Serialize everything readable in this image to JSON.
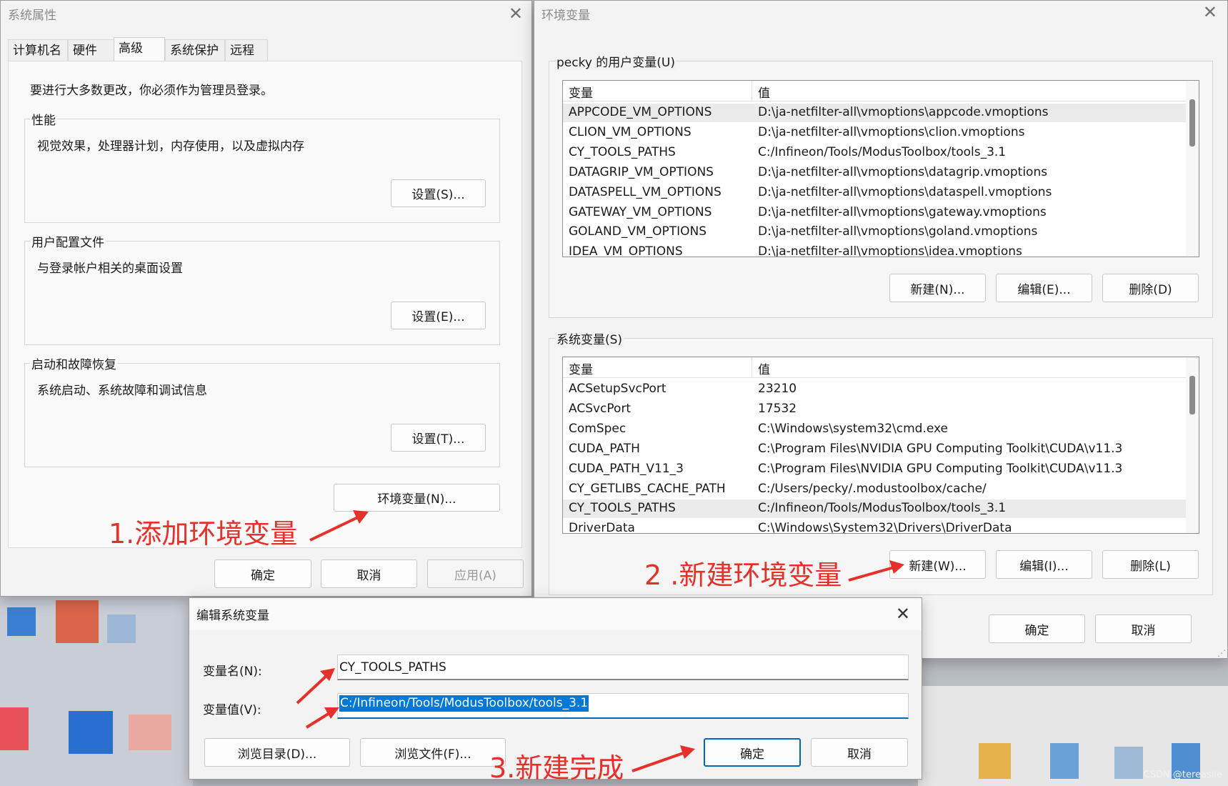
{
  "system_properties": {
    "title": "系统属性",
    "tabs": [
      "计算机名",
      "硬件",
      "高级",
      "系统保护",
      "远程"
    ],
    "admin_notice": "要进行大多数更改，你必须作为管理员登录。",
    "performance": {
      "heading": "性能",
      "description": "视觉效果，处理器计划，内存使用，以及虚拟内存",
      "button": "设置(S)..."
    },
    "user_profiles": {
      "heading": "用户配置文件",
      "description": "与登录帐户相关的桌面设置",
      "button": "设置(E)..."
    },
    "startup_recovery": {
      "heading": "启动和故障恢复",
      "description": "系统启动、系统故障和调试信息",
      "button": "设置(T)..."
    },
    "env_button": "环境变量(N)...",
    "ok": "确定",
    "cancel": "取消",
    "apply": "应用(A)"
  },
  "env_vars": {
    "title": "环境变量",
    "user_section": "pecky 的用户变量(U)",
    "system_section": "系统变量(S)",
    "col_var": "变量",
    "col_val": "值",
    "user_rows": [
      {
        "name": "APPCODE_VM_OPTIONS",
        "value": "D:\\ja-netfilter-all\\vmoptions\\appcode.vmoptions"
      },
      {
        "name": "CLION_VM_OPTIONS",
        "value": "D:\\ja-netfilter-all\\vmoptions\\clion.vmoptions"
      },
      {
        "name": "CY_TOOLS_PATHS",
        "value": "C:/Infineon/Tools/ModusToolbox/tools_3.1"
      },
      {
        "name": "DATAGRIP_VM_OPTIONS",
        "value": "D:\\ja-netfilter-all\\vmoptions\\datagrip.vmoptions"
      },
      {
        "name": "DATASPELL_VM_OPTIONS",
        "value": "D:\\ja-netfilter-all\\vmoptions\\dataspell.vmoptions"
      },
      {
        "name": "GATEWAY_VM_OPTIONS",
        "value": "D:\\ja-netfilter-all\\vmoptions\\gateway.vmoptions"
      },
      {
        "name": "GOLAND_VM_OPTIONS",
        "value": "D:\\ja-netfilter-all\\vmoptions\\goland.vmoptions"
      },
      {
        "name": "IDEA_VM_OPTIONS",
        "value": "D:\\ja-netfilter-all\\vmoptions\\idea.vmoptions"
      }
    ],
    "system_rows": [
      {
        "name": "ACSetupSvcPort",
        "value": "23210"
      },
      {
        "name": "ACSvcPort",
        "value": "17532"
      },
      {
        "name": "ComSpec",
        "value": "C:\\Windows\\system32\\cmd.exe"
      },
      {
        "name": "CUDA_PATH",
        "value": "C:\\Program Files\\NVIDIA GPU Computing Toolkit\\CUDA\\v11.3"
      },
      {
        "name": "CUDA_PATH_V11_3",
        "value": "C:\\Program Files\\NVIDIA GPU Computing Toolkit\\CUDA\\v11.3"
      },
      {
        "name": "CY_GETLIBS_CACHE_PATH",
        "value": "C:/Users/pecky/.modustoolbox/cache/"
      },
      {
        "name": "CY_TOOLS_PATHS",
        "value": "C:/Infineon/Tools/ModusToolbox/tools_3.1"
      },
      {
        "name": "DriverData",
        "value": "C:\\Windows\\System32\\Drivers\\DriverData"
      }
    ],
    "user_buttons": [
      "新建(N)...",
      "编辑(E)...",
      "删除(D)"
    ],
    "system_buttons": [
      "新建(W)...",
      "编辑(I)...",
      "删除(L)"
    ],
    "ok": "确定",
    "cancel": "取消"
  },
  "edit_dialog": {
    "title": "编辑系统变量",
    "name_label": "变量名(N):",
    "name_value": "CY_TOOLS_PATHS",
    "value_label": "变量值(V):",
    "value_value": "C:/Infineon/Tools/ModusToolbox/tools_3.1",
    "browse_dir": "浏览目录(D)...",
    "browse_file": "浏览文件(F)...",
    "ok": "确定",
    "cancel": "取消"
  },
  "annotations": {
    "step1": "1.添加环境变量",
    "step2": "2 .新建环境变量",
    "step3": "3.新建完成"
  },
  "watermark": "CSDN @tereasile",
  "colors": {
    "annotation_red": "#e8302a",
    "selection_blue": "#0078d7",
    "focus_blue": "#0067c0"
  }
}
